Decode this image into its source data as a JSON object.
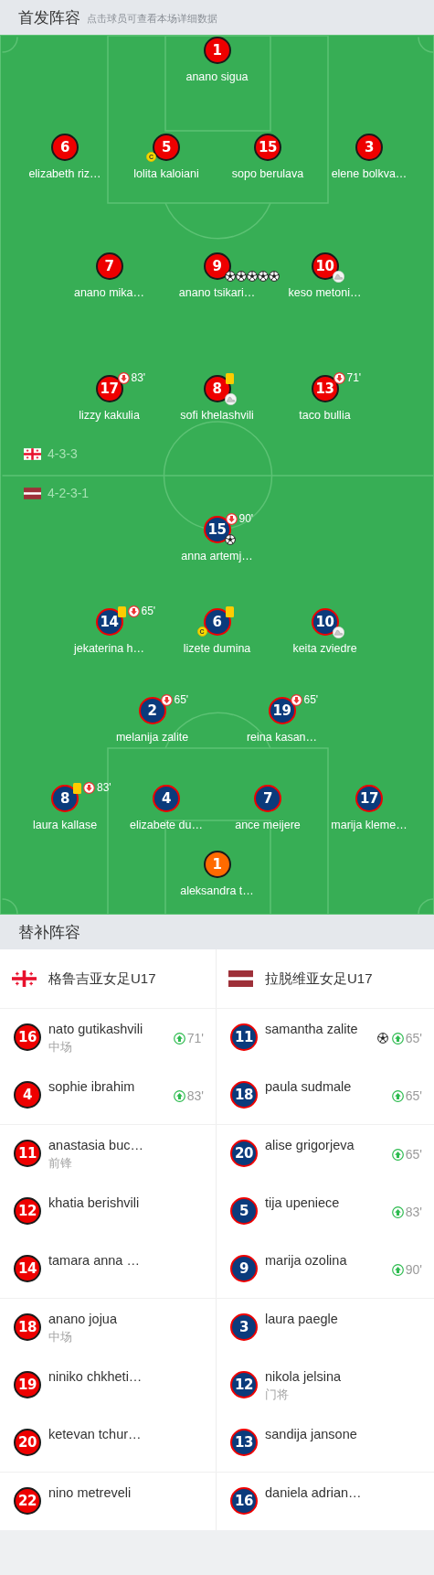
{
  "header": {
    "title": "首发阵容",
    "subtitle": "点击球员可查看本场详细数据"
  },
  "pitch": {
    "home": {
      "kind": "home",
      "color": "#ee0000",
      "lines": [
        [
          {
            "number": "1",
            "name": "anano sigua"
          }
        ],
        [
          {
            "number": "6",
            "name": "elizabeth riz…"
          },
          {
            "number": "5",
            "name": "lolita kaloiani",
            "events": [
              {
                "kind": "captain",
                "label": "C"
              }
            ]
          },
          {
            "number": "15",
            "name": "sopo berulava"
          },
          {
            "number": "3",
            "name": "elene bolkva…"
          }
        ],
        [
          {
            "number": "7",
            "name": "anano mika…"
          },
          {
            "number": "9",
            "name": "anano tsikari…",
            "events": [
              {
                "kind": "goal"
              },
              {
                "kind": "goal"
              },
              {
                "kind": "goal"
              },
              {
                "kind": "goal"
              },
              {
                "kind": "goal"
              }
            ]
          },
          {
            "number": "10",
            "name": "keso metoni…",
            "events": [
              {
                "kind": "assist"
              }
            ]
          }
        ],
        [
          {
            "number": "17",
            "name": "lizzy kakulia",
            "events": [
              {
                "kind": "sub_off",
                "minute": "83'"
              }
            ]
          },
          {
            "number": "8",
            "name": "sofi khelashvili",
            "events": [
              {
                "kind": "yellow_card"
              },
              {
                "kind": "assist"
              }
            ]
          },
          {
            "number": "13",
            "name": "taco bullia",
            "events": [
              {
                "kind": "sub_off",
                "minute": "71'"
              }
            ]
          }
        ]
      ]
    },
    "formations": [
      {
        "kind": "georgia",
        "label": "4-3-3"
      },
      {
        "kind": "latvia",
        "label": "4-2-3-1"
      }
    ],
    "away": {
      "kind": "away",
      "color": "#0b3b7c",
      "lines": [
        [
          {
            "number": "15",
            "name": "anna artemj…",
            "events": [
              {
                "kind": "sub_off",
                "minute": "90'"
              },
              {
                "kind": "goal"
              }
            ]
          }
        ],
        [
          {
            "number": "14",
            "name": "jekaterina h…",
            "events": [
              {
                "kind": "yellow_card"
              },
              {
                "kind": "sub_off",
                "minute": "65'"
              }
            ]
          },
          {
            "number": "6",
            "name": "lizete dumina",
            "events": [
              {
                "kind": "captain",
                "label": "C"
              },
              {
                "kind": "yellow_card"
              }
            ]
          },
          {
            "number": "10",
            "name": "keita zviedre",
            "events": [
              {
                "kind": "assist"
              }
            ]
          }
        ],
        [
          {
            "number": "2",
            "name": "melanija zalite",
            "events": [
              {
                "kind": "sub_off",
                "minute": "65'"
              }
            ]
          },
          {
            "number": "19",
            "name": "reina kasan…",
            "events": [
              {
                "kind": "sub_off",
                "minute": "65'"
              }
            ]
          }
        ],
        [
          {
            "number": "8",
            "name": "laura kallase",
            "events": [
              {
                "kind": "yellow_card"
              },
              {
                "kind": "sub_off",
                "minute": "83'"
              }
            ]
          },
          {
            "number": "4",
            "name": "elizabete du…"
          },
          {
            "number": "7",
            "name": "ance meijere"
          },
          {
            "number": "17",
            "name": "marija kleme…"
          }
        ],
        [
          {
            "kind": "goalkeeper",
            "number": "1",
            "name": "aleksandra t…",
            "color": "#ff6a00"
          }
        ]
      ]
    }
  },
  "substitutes": {
    "title": "替补阵容",
    "teams": [
      {
        "kind": "georgia",
        "name": "格鲁吉亚女足U17"
      },
      {
        "kind": "latvia",
        "name": "拉脱维亚女足U17"
      }
    ],
    "groups": [
      {
        "home": [
          {
            "number": "16",
            "name": "nato gutikashvili",
            "position": "中场",
            "events": [
              {
                "kind": "sub_on",
                "minute": "71'"
              }
            ]
          },
          {
            "number": "4",
            "name": "sophie ibrahim",
            "events": [
              {
                "kind": "sub_on",
                "minute": "83'"
              }
            ]
          }
        ],
        "away": [
          {
            "number": "11",
            "name": "samantha zalite",
            "events": [
              {
                "kind": "goal"
              },
              {
                "kind": "sub_on",
                "minute": "65'"
              }
            ]
          },
          {
            "number": "18",
            "name": "paula sudmale",
            "events": [
              {
                "kind": "sub_on",
                "minute": "65'"
              }
            ]
          }
        ]
      },
      {
        "home": [
          {
            "number": "11",
            "name": "anastasia buc…",
            "position": "前锋"
          },
          {
            "number": "12",
            "name": "khatia berishvili"
          },
          {
            "number": "14",
            "name": "tamara anna …"
          }
        ],
        "away": [
          {
            "number": "20",
            "name": "alise grigorjeva",
            "events": [
              {
                "kind": "sub_on",
                "minute": "65'"
              }
            ]
          },
          {
            "number": "5",
            "name": "tija upeniece",
            "events": [
              {
                "kind": "sub_on",
                "minute": "83'"
              }
            ]
          },
          {
            "number": "9",
            "name": "marija ozolina",
            "events": [
              {
                "kind": "sub_on",
                "minute": "90'"
              }
            ]
          }
        ]
      },
      {
        "home": [
          {
            "number": "18",
            "name": "anano jojua",
            "position": "中场"
          },
          {
            "number": "19",
            "name": "niniko chkheti…"
          },
          {
            "number": "20",
            "name": "ketevan tchur…"
          }
        ],
        "away": [
          {
            "number": "3",
            "name": "laura paegle"
          },
          {
            "number": "12",
            "name": "nikola jelsina",
            "position": "门将"
          },
          {
            "number": "13",
            "name": "sandija jansone"
          }
        ]
      },
      {
        "home": [
          {
            "number": "22",
            "name": "nino metreveli"
          }
        ],
        "away": [
          {
            "number": "16",
            "name": "daniela adrian…"
          }
        ]
      }
    ]
  }
}
